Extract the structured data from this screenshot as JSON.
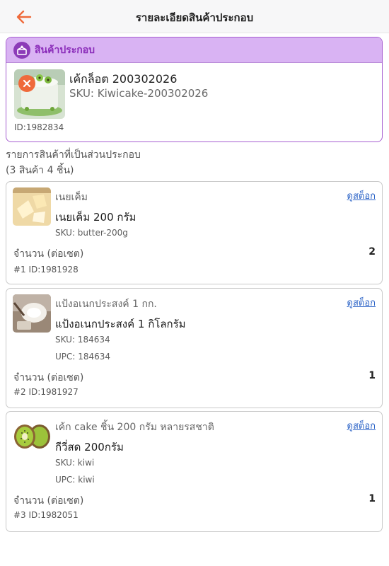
{
  "colors": {
    "accent": "#ef6a3b",
    "bundle_header_bg": "#d9b3f3",
    "bundle_border": "#a65ed0",
    "link": "#2b63c7"
  },
  "header": {
    "back_icon": "arrow-left-icon",
    "title": "รายละเอียดสินค้าประกอบ"
  },
  "bundle": {
    "header_icon": "bundle-box-icon",
    "header_label": "สินค้าประกอบ",
    "name": "เค้กล็อต 200302026",
    "sku": "SKU: Kiwicake-200302026",
    "id": "ID:1982834"
  },
  "components_title": {
    "line1": "รายการสินค้าที่เป็นส่วนประกอบ",
    "line2": "(3 สินค้า 4 ชิ้น)"
  },
  "components": [
    {
      "group": "เนยเค็ม",
      "name": "เนยเค็ม 200 กรัม",
      "sku": "SKU: butter-200g",
      "upc": "",
      "stock_link": "ดูสต็อก",
      "qty_label": "จำนวน (ต่อเซต)",
      "qty": "2",
      "id": "#1 ID:1981928"
    },
    {
      "group": "แป้งอเนกประสงค์ 1 กก.",
      "name": "แป้งอเนกประสงค์ 1 กิโลกรัม",
      "sku": "SKU: 184634",
      "upc": "UPC: 184634",
      "stock_link": "ดูสต็อก",
      "qty_label": "จำนวน (ต่อเซต)",
      "qty": "1",
      "id": "#2 ID:1981927"
    },
    {
      "group": "เค้ก cake ชิ้น 200 กรัม หลายรสชาติ",
      "name": "กีวี่สด 200กรัม",
      "sku": "SKU: kiwi",
      "upc": "UPC: kiwi",
      "stock_link": "ดูสต็อก",
      "qty_label": "จำนวน (ต่อเซต)",
      "qty": "1",
      "id": "#3 ID:1982051"
    }
  ]
}
